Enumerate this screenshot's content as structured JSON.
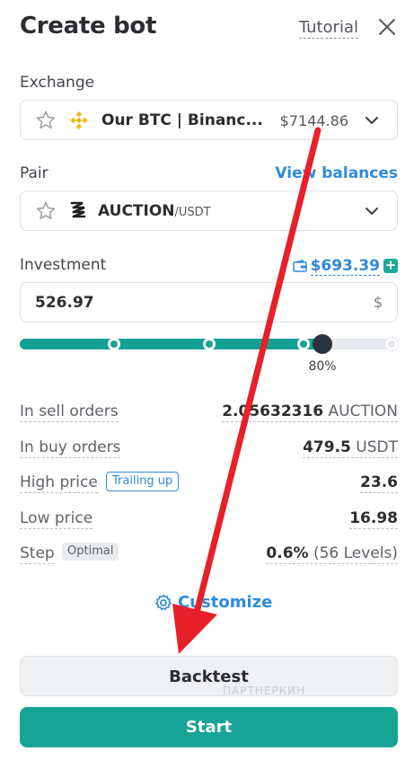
{
  "header": {
    "title": "Create bot",
    "tutorial_label": "Tutorial"
  },
  "exchange": {
    "label": "Exchange",
    "name": "Our BTC | Binanc...",
    "value": "$7144.86",
    "icon": "binance-logo-icon"
  },
  "pair": {
    "label": "Pair",
    "view_balances": "View balances",
    "base": "AUCTION",
    "quote": "/USDT"
  },
  "investment": {
    "label": "Investment",
    "balance": "$693.39",
    "value": "526.97",
    "unit": "$",
    "slider_percent_label": "80%",
    "slider_fraction": 0.8
  },
  "details": {
    "sell_orders": {
      "label": "In sell orders",
      "value": "2.05632316",
      "unit": "AUCTION"
    },
    "buy_orders": {
      "label": "In buy orders",
      "value": "479.5",
      "unit": "USDT"
    },
    "high_price": {
      "label": "High price",
      "tag": "Trailing up",
      "value": "23.6"
    },
    "low_price": {
      "label": "Low price",
      "value": "16.98"
    },
    "step": {
      "label": "Step",
      "tag": "Optimal",
      "value": "0.6%",
      "levels": "(56 Levels)"
    }
  },
  "customize_label": "Customize",
  "buttons": {
    "backtest": "Backtest",
    "start": "Start"
  },
  "watermark": "ПАРТНЕРКИН",
  "colors": {
    "accent": "#17a497",
    "link": "#2f8bd8",
    "annotation_arrow": "#e8202a"
  }
}
